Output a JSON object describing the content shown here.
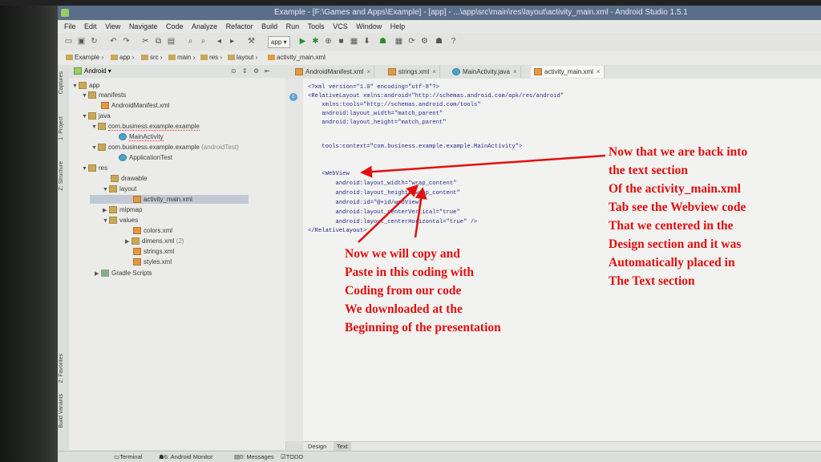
{
  "window": {
    "title": "Example - [F:\\Games and Apps\\Example] - [app] - ...\\app\\src\\main\\res\\layout\\activity_main.xml - Android Studio 1.5.1"
  },
  "menu": [
    "File",
    "Edit",
    "View",
    "Navigate",
    "Code",
    "Analyze",
    "Refactor",
    "Build",
    "Run",
    "Tools",
    "VCS",
    "Window",
    "Help"
  ],
  "toolbar": {
    "run_config": "app"
  },
  "breadcrumb": [
    "Example",
    "app",
    "src",
    "main",
    "res",
    "layout",
    "activity_main.xml"
  ],
  "project_panel": {
    "view_mode": "Android"
  },
  "side_tabs": {
    "captures": "Captures",
    "project": "1: Project",
    "structure": "Z: Structure",
    "favorites": "2: Favorites",
    "build_variants": "Build Variants"
  },
  "tree": [
    {
      "label": "app",
      "hint": "",
      "indent": 0
    },
    {
      "label": "manifests",
      "hint": "",
      "indent": 1
    },
    {
      "label": "AndroidManifest.xml",
      "hint": "",
      "indent": 2
    },
    {
      "label": "java",
      "hint": "",
      "indent": 1
    },
    {
      "label": "com.business.example.example",
      "hint": "",
      "indent": 2
    },
    {
      "label": "MainActivity",
      "hint": "",
      "indent": 3
    },
    {
      "label": "com.business.example.example",
      "hint": "(androidTest)",
      "indent": 2
    },
    {
      "label": "ApplicationTest",
      "hint": "",
      "indent": 3
    },
    {
      "label": "res",
      "hint": "",
      "indent": 1
    },
    {
      "label": "drawable",
      "hint": "",
      "indent": 2
    },
    {
      "label": "layout",
      "hint": "",
      "indent": 2
    },
    {
      "label": "activity_main.xml",
      "hint": "",
      "indent": 3
    },
    {
      "label": "mipmap",
      "hint": "",
      "indent": 2
    },
    {
      "label": "values",
      "hint": "",
      "indent": 2
    },
    {
      "label": "colors.xml",
      "hint": "",
      "indent": 3
    },
    {
      "label": "dimens.xml",
      "hint": "(2)",
      "indent": 3
    },
    {
      "label": "strings.xml",
      "hint": "",
      "indent": 3
    },
    {
      "label": "styles.xml",
      "hint": "",
      "indent": 3
    },
    {
      "label": "Gradle Scripts",
      "hint": "",
      "indent": 0
    }
  ],
  "editor_tabs": [
    "AndroidManifest.xml",
    "strings.xml",
    "MainActivity.java",
    "activity_main.xml"
  ],
  "code": [
    "<?xml version=\"1.0\" encoding=\"utf-8\"?>",
    "<RelativeLayout xmlns:android=\"http://schemas.android.com/apk/res/android\"",
    "    xmlns:tools=\"http://schemas.android.com/tools\"",
    "    android:layout_width=\"match_parent\"",
    "    android:layout_height=\"match_parent\"",
    "",
    "    tools:context=\"com.business.example.example.MainActivity\">",
    "",
    "",
    "    <WebView",
    "        android:layout_width=\"wrap_content\"",
    "        android:layout_height=\"wrap_content\"",
    "        android:id=\"@+id/webView\"",
    "        android:layout_centerVertical=\"true\"",
    "        android:layout_centerHorizontal=\"true\" />",
    "</RelativeLayout>"
  ],
  "bottom_tabs": {
    "design": "Design",
    "text": "Text"
  },
  "status_bar": {
    "terminal": "Terminal",
    "monitor": "6: Android Monitor",
    "messages": "0: Messages",
    "todo": "TODO"
  },
  "annotations": {
    "right": [
      "Now that we are back into",
      "the text section",
      "Of the activity_main.xml",
      "Tab see the Webview code",
      "That we centered in the",
      "Design section and it was",
      "Automatically placed in",
      "The Text section"
    ],
    "bottom": [
      "Now we will copy and",
      "Paste in this coding with",
      "Coding from our code",
      "We downloaded at the",
      "Beginning of the presentation"
    ]
  },
  "colors": {
    "annotation": "#e01010",
    "title_bar": "#5a6e8a"
  }
}
